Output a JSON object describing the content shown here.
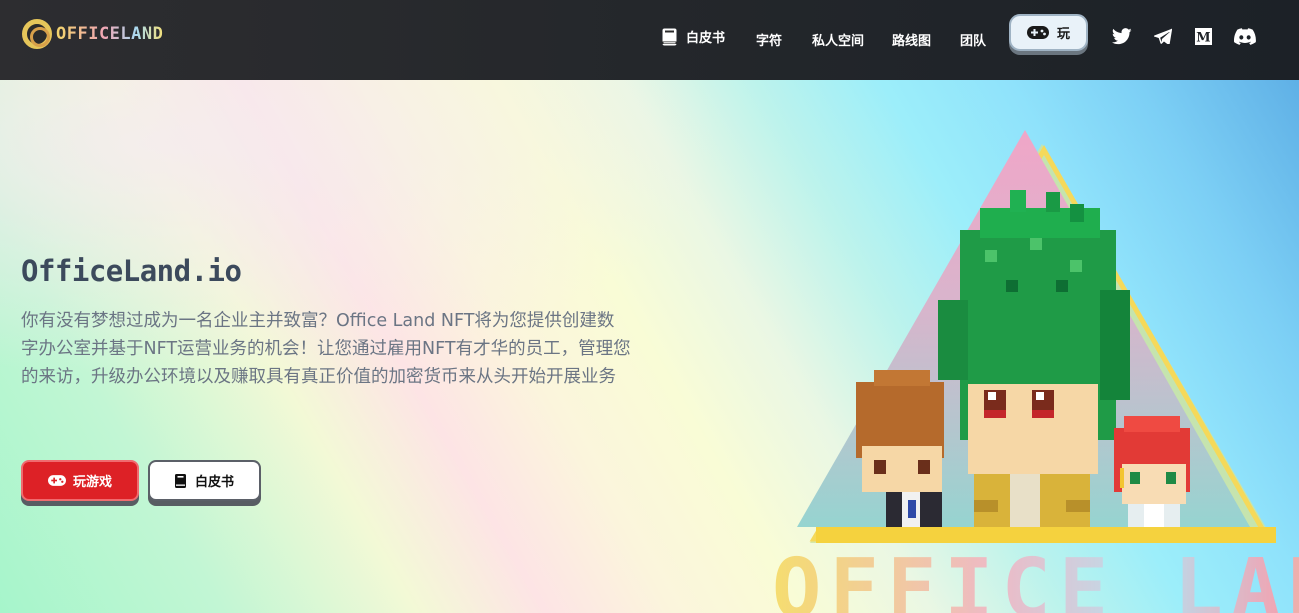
{
  "brand": {
    "logo_text": "OFFICELAND"
  },
  "nav": {
    "whitepaper": "白皮书",
    "runes": "字符",
    "private_space": "私人空间",
    "roadmap": "路线图",
    "team": "团队",
    "play": "玩"
  },
  "social": [
    "twitter-icon",
    "telegram-icon",
    "medium-icon",
    "discord-icon"
  ],
  "hero": {
    "title": "OfficeLand.io",
    "description": "你有没有梦想过成为一名企业主并致富？Office Land NFT将为您提供创建数字办公室并基于NFT运营业务的机会！让您通过雇用NFT有才华的员工，管理您的来访，升级办公环境以及赚取具有真正价值的加密货币来从头开始开展业务",
    "play_button": "玩游戏",
    "whitepaper_button": "白皮书",
    "art_logo": "OFFICE LAND"
  },
  "colors": {
    "play_red": "#dd2126",
    "navbar": "#2d2d30",
    "title": "#3c4a5c",
    "desc": "#6b7584"
  }
}
